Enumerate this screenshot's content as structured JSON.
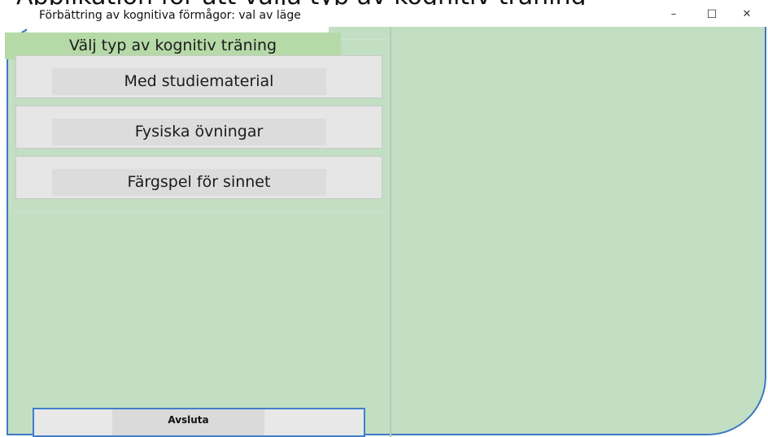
{
  "window": {
    "title": "Förbättring av kognitiva förmågor: val av läge",
    "minimize_glyph": "–",
    "maximize_glyph": "☐",
    "close_glyph": "✕"
  },
  "background_heading": "Applikation för att välja typ av kognitiv träning",
  "panel": {
    "section_label": "Välj typ av kognitiv träning",
    "options": [
      {
        "label": "Med studiematerial"
      },
      {
        "label": "Fysiska övningar"
      },
      {
        "label": "Färgspel för sinnet"
      }
    ]
  },
  "footer": {
    "exit_label": "Avsluta"
  },
  "colors": {
    "surface": "#c2dec3",
    "label_bg": "#b5d9a7",
    "button_bg": "#e6e6e6",
    "accent_border": "#3d79c2"
  }
}
